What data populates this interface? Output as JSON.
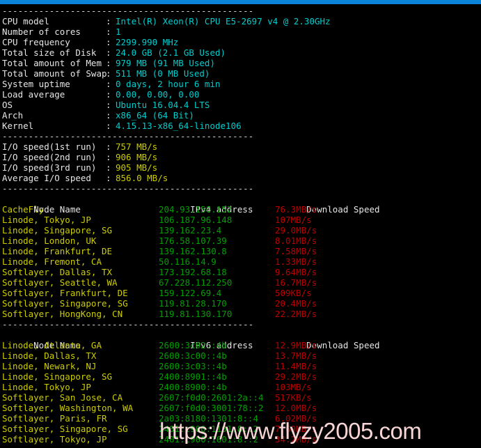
{
  "titlebar": {
    "color": "#0a84d8"
  },
  "separator": "------------------------------------------------",
  "sysinfo": [
    {
      "label": "CPU model",
      "value": "Intel(R) Xeon(R) CPU E5-2697 v4 @ 2.30GHz"
    },
    {
      "label": "Number of cores",
      "value": "1"
    },
    {
      "label": "CPU frequency",
      "value": "2299.990 MHz"
    },
    {
      "label": "Total size of Disk",
      "value": "24.0 GB (2.1 GB Used)"
    },
    {
      "label": "Total amount of Mem",
      "value": "979 MB (91 MB Used)"
    },
    {
      "label": "Total amount of Swap",
      "value": "511 MB (0 MB Used)"
    },
    {
      "label": "System uptime",
      "value": "0 days, 2 hour 6 min"
    },
    {
      "label": "Load average",
      "value": "0.00, 0.00, 0.00"
    },
    {
      "label": "OS",
      "value": "Ubuntu 16.04.4 LTS"
    },
    {
      "label": "Arch",
      "value": "x86_64 (64 Bit)"
    },
    {
      "label": "Kernel",
      "value": "4.15.13-x86_64-linode106"
    }
  ],
  "iospeed": [
    {
      "label": "I/O speed(1st run)",
      "value": "757 MB/s"
    },
    {
      "label": "I/O speed(2nd run)",
      "value": "906 MB/s"
    },
    {
      "label": "I/O speed(3rd run)",
      "value": "905 MB/s"
    },
    {
      "label": "Average I/O speed",
      "value": "856.0 MB/s"
    }
  ],
  "ipv4_table": {
    "headers": {
      "node": "Node Name",
      "address": "IPv4 address",
      "speed": "Download Speed"
    },
    "rows": [
      {
        "node": "CacheFly",
        "address": "204.93.150.152",
        "speed": "76.3MB/s"
      },
      {
        "node": "Linode, Tokyo, JP",
        "address": "106.187.96.148",
        "speed": "107MB/s"
      },
      {
        "node": "Linode, Singapore, SG",
        "address": "139.162.23.4",
        "speed": "29.0MB/s"
      },
      {
        "node": "Linode, London, UK",
        "address": "176.58.107.39",
        "speed": "8.01MB/s"
      },
      {
        "node": "Linode, Frankfurt, DE",
        "address": "139.162.130.8",
        "speed": "7.58MB/s"
      },
      {
        "node": "Linode, Fremont, CA",
        "address": "50.116.14.9",
        "speed": "1.33MB/s"
      },
      {
        "node": "Softlayer, Dallas, TX",
        "address": "173.192.68.18",
        "speed": "9.64MB/s"
      },
      {
        "node": "Softlayer, Seattle, WA",
        "address": "67.228.112.250",
        "speed": "16.7MB/s"
      },
      {
        "node": "Softlayer, Frankfurt, DE",
        "address": "159.122.69.4",
        "speed": "509KB/s"
      },
      {
        "node": "Softlayer, Singapore, SG",
        "address": "119.81.28.170",
        "speed": "20.4MB/s"
      },
      {
        "node": "Softlayer, HongKong, CN",
        "address": "119.81.130.170",
        "speed": "22.2MB/s"
      }
    ]
  },
  "ipv6_table": {
    "headers": {
      "node": "Node Name",
      "address": "IPv6 address",
      "speed": "Download Speed"
    },
    "rows": [
      {
        "node": "Linode, Atlanta, GA",
        "address": "2600:3c02::4b",
        "speed": "12.9MB/s"
      },
      {
        "node": "Linode, Dallas, TX",
        "address": "2600:3c00::4b",
        "speed": "13.7MB/s"
      },
      {
        "node": "Linode, Newark, NJ",
        "address": "2600:3c03::4b",
        "speed": "11.4MB/s"
      },
      {
        "node": "Linode, Singapore, SG",
        "address": "2400:8901::4b",
        "speed": "29.2MB/s"
      },
      {
        "node": "Linode, Tokyo, JP",
        "address": "2400:8900::4b",
        "speed": "103MB/s"
      },
      {
        "node": "Softlayer, San Jose, CA",
        "address": "2607:f0d0:2601:2a::4",
        "speed": "517KB/s"
      },
      {
        "node": "Softlayer, Washington, WA",
        "address": "2607:f0d0:3001:78::2",
        "speed": "12.0MB/s"
      },
      {
        "node": "Softlayer, Paris, FR",
        "address": "2a03:8180:1301:8::4",
        "speed": "6.02MB/s"
      },
      {
        "node": "Softlayer, Singapore, SG",
        "address": "2401:c900:1101:8::2",
        "speed": "7.69MB/s"
      },
      {
        "node": "Softlayer, Tokyo, JP",
        "address": "2401:c900:1001:8::2",
        "speed": "34.2MB/s"
      }
    ]
  },
  "watermark": {
    "text": "https://www.flyzy2005.com"
  }
}
